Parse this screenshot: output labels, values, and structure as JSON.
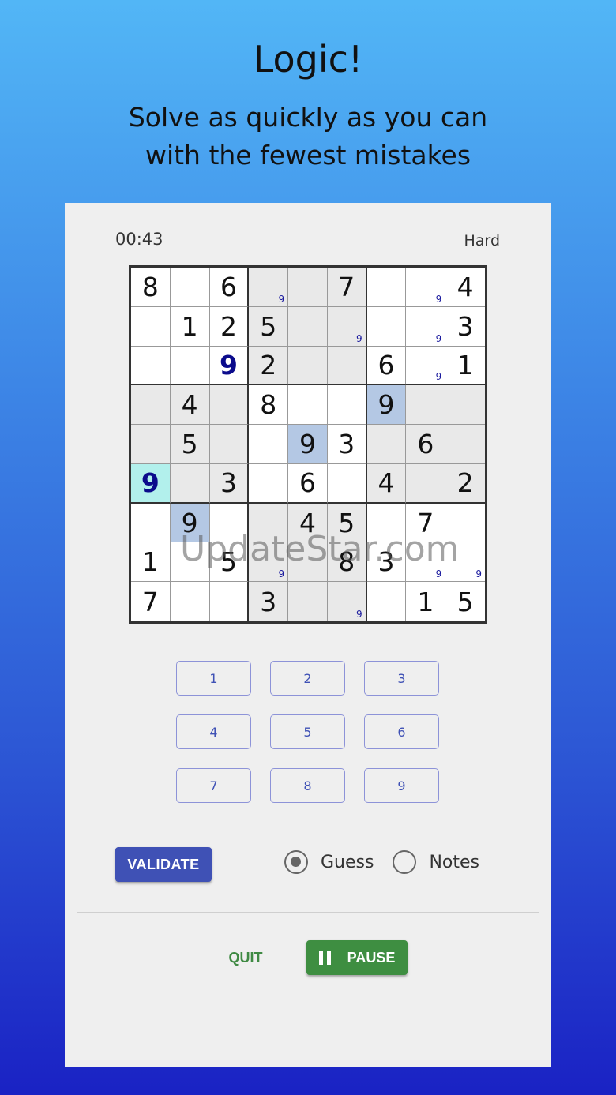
{
  "header": {
    "title": "Logic!",
    "subtitle_line1": "Solve as quickly as you can",
    "subtitle_line2": "with the fewest mistakes"
  },
  "status": {
    "timer": "00:43",
    "difficulty": "Hard"
  },
  "board": {
    "values": [
      [
        "8",
        "",
        "6",
        "",
        "",
        "7",
        "",
        "",
        "4"
      ],
      [
        "",
        "1",
        "2",
        "5",
        "",
        "",
        "",
        "",
        "3"
      ],
      [
        "",
        "",
        "9",
        "2",
        "",
        "",
        "6",
        "",
        "1"
      ],
      [
        "",
        "4",
        "",
        "8",
        "",
        "",
        "9",
        "",
        ""
      ],
      [
        "",
        "5",
        "",
        "",
        "9",
        "3",
        "",
        "6",
        ""
      ],
      [
        "9",
        "",
        "3",
        "",
        "6",
        "",
        "4",
        "",
        "2"
      ],
      [
        "",
        "9",
        "",
        "",
        "4",
        "5",
        "",
        "7",
        ""
      ],
      [
        "1",
        "",
        "5",
        "",
        "",
        "8",
        "3",
        "",
        ""
      ],
      [
        "7",
        "",
        "",
        "3",
        "",
        "",
        "",
        "1",
        "5"
      ]
    ],
    "notes": [
      [
        "",
        "",
        "",
        "9",
        "",
        "",
        "",
        "9",
        ""
      ],
      [
        "",
        "",
        "",
        "",
        "",
        "9",
        "",
        "9",
        ""
      ],
      [
        "",
        "",
        "",
        "",
        "",
        "",
        "",
        "9",
        ""
      ],
      [
        "",
        "",
        "",
        "",
        "",
        "",
        "",
        "",
        ""
      ],
      [
        "",
        "",
        "",
        "",
        "",
        "",
        "",
        "",
        ""
      ],
      [
        "",
        "",
        "",
        "",
        "",
        "",
        "",
        "",
        ""
      ],
      [
        "",
        "",
        "",
        "",
        "",
        "",
        "",
        "",
        ""
      ],
      [
        "",
        "",
        "",
        "9",
        "",
        "",
        "",
        "9",
        "9"
      ],
      [
        "",
        "",
        "",
        "",
        "",
        "9",
        "",
        "",
        ""
      ]
    ],
    "guess_cells": [
      [
        2,
        2
      ],
      [
        5,
        0
      ]
    ],
    "selected_cell": [
      5,
      0
    ],
    "highlighted_cells": [
      [
        3,
        6
      ],
      [
        4,
        4
      ],
      [
        6,
        1
      ]
    ]
  },
  "numpad": [
    "1",
    "2",
    "3",
    "4",
    "5",
    "6",
    "7",
    "8",
    "9"
  ],
  "controls": {
    "validate_label": "VALIDATE",
    "mode_guess_label": "Guess",
    "mode_notes_label": "Notes",
    "selected_mode": "Guess",
    "quit_label": "QUIT",
    "pause_label": "PAUSE"
  },
  "watermark": "UpdateStar.com",
  "colors": {
    "primary": "#3f51b5",
    "success": "#3e8e41",
    "selected_cell": "#b2f0ec",
    "highlight_cell": "#b4c8e4",
    "guess_digit": "#0b0b8c"
  }
}
